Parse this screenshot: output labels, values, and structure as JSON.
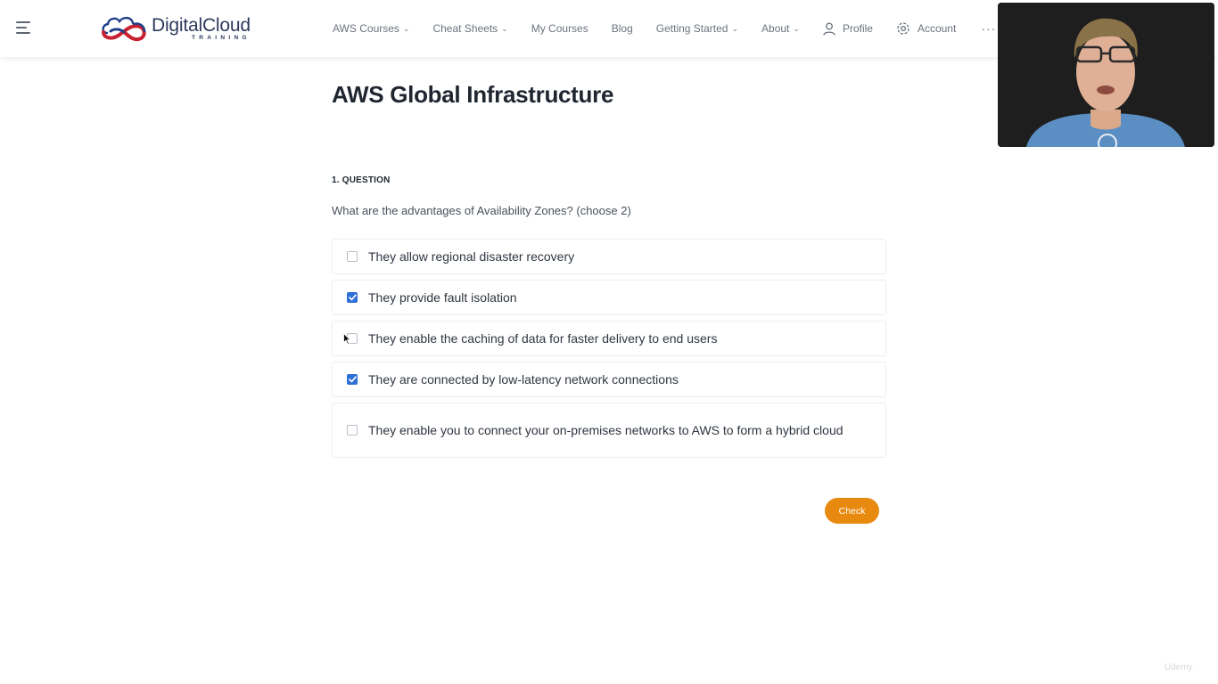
{
  "brand": {
    "name": "DigitalCloud",
    "tagline": "TRAINING",
    "colors": {
      "red": "#c8202e",
      "navy": "#1f3f8a"
    }
  },
  "nav": {
    "items": [
      {
        "label": "AWS Courses",
        "dropdown": true
      },
      {
        "label": "Cheat Sheets",
        "dropdown": true
      },
      {
        "label": "My Courses",
        "dropdown": false
      },
      {
        "label": "Blog",
        "dropdown": false
      },
      {
        "label": "Getting Started",
        "dropdown": true
      },
      {
        "label": "About",
        "dropdown": true
      }
    ],
    "profile_label": "Profile",
    "account_label": "Account",
    "more_label": "···"
  },
  "page": {
    "title": "AWS Global Infrastructure",
    "question_label": "1. QUESTION",
    "question_text": "What are the advantages of Availability Zones? (choose 2)",
    "options": [
      {
        "text": "They allow regional disaster recovery",
        "checked": false
      },
      {
        "text": "They provide fault isolation",
        "checked": true
      },
      {
        "text": "They enable the caching of data for faster delivery to end users",
        "checked": false
      },
      {
        "text": "They are connected by low-latency network connections",
        "checked": true
      },
      {
        "text": "They enable you to connect your on-premises networks to AWS to form a hybrid cloud",
        "checked": false
      }
    ],
    "check_button": "Check"
  },
  "watermark": "Udemy",
  "colors": {
    "accent_orange": "#e88a10",
    "checkbox_blue": "#2f6fd8",
    "title_dark": "#1f2630"
  }
}
